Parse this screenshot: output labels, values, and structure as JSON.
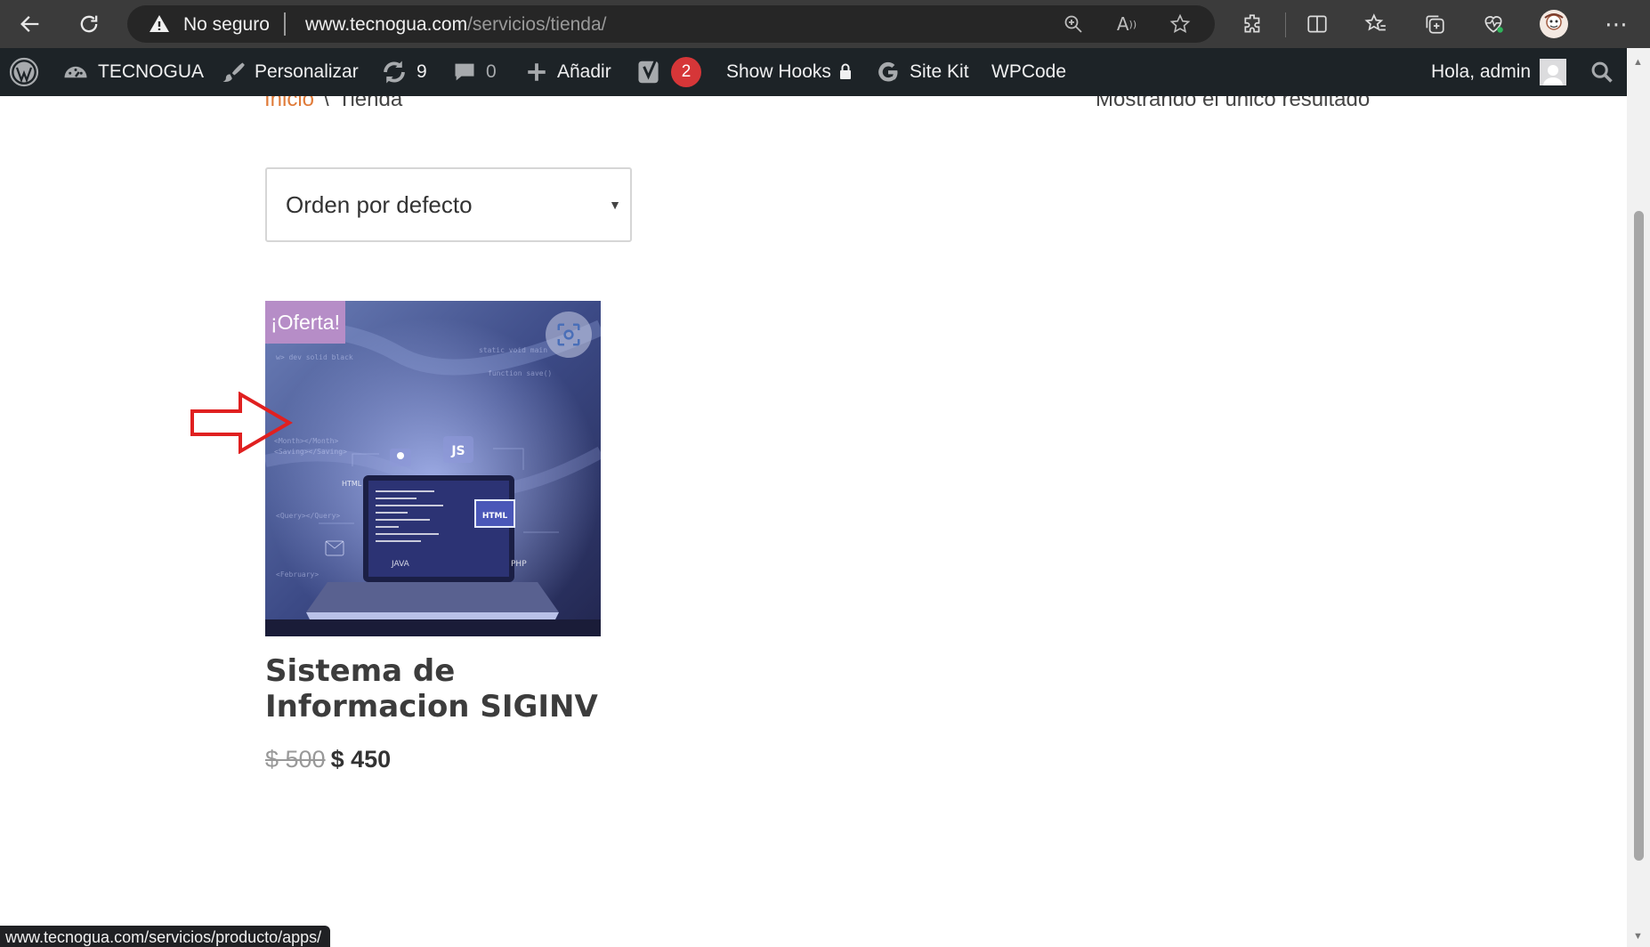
{
  "browser": {
    "security_label": "No seguro",
    "url_host": "www.tecnogua.com",
    "url_path": "/servicios/tienda/",
    "status_url": "www.tecnogua.com/servicios/producto/apps/"
  },
  "admin_bar": {
    "site_name": "TECNOGUA",
    "customize": "Personalizar",
    "updates_count": "9",
    "comments_count": "0",
    "add_new": "Añadir",
    "yoast_badge": "2",
    "show_hooks": "Show Hooks",
    "site_kit": "Site Kit",
    "wpcode": "WPCode",
    "greeting": "Hola, admin"
  },
  "shop": {
    "breadcrumb_home": "Inicio",
    "breadcrumb_sep": "\\",
    "breadcrumb_current": "Tienda",
    "result_count": "Mostrando el único resultado",
    "orderby_label": "Orden por defecto",
    "product": {
      "sale_badge": "¡Oferta!",
      "title": "Sistema de Informacion SIGINV",
      "price_old": "$ 500",
      "price_new": "$ 450",
      "image_labels": {
        "js": "JS",
        "html": "HTML",
        "java": "JAVA",
        "php": "PHP"
      }
    }
  },
  "colors": {
    "browser_bar": "#3b3b3b",
    "admin_bar": "#1d2327",
    "breadcrumb_link": "#e07b39",
    "sale_badge": "#b68dc7",
    "annotation_arrow": "#e02020"
  },
  "icons": {
    "back": "arrow-left-icon",
    "reload": "reload-icon",
    "warning": "warning-triangle-icon",
    "wordpress": "wordpress-logo-icon",
    "dashboard": "dashboard-gauge-icon",
    "customize": "brush-icon",
    "updates": "refresh-icon",
    "comments": "comment-icon",
    "add": "plus-icon",
    "yoast": "yoast-icon",
    "lock": "lock-icon",
    "google": "google-g-icon",
    "search": "search-icon"
  }
}
